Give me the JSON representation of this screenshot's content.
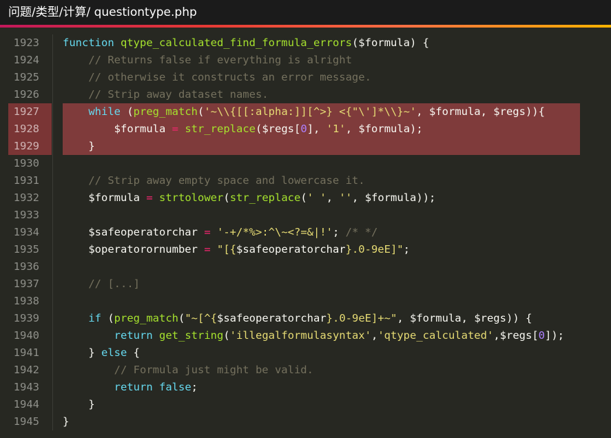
{
  "window": {
    "title": "问题/类型/计算/ questiontype.php"
  },
  "theme": {
    "background": "#272822",
    "highlight": "#7f3b3b",
    "accent": [
      "#c2185b",
      "#ffb300"
    ]
  },
  "lines": [
    {
      "n": "1923",
      "hl": false,
      "tokens": [
        {
          "t": "kw",
          "v": "function"
        },
        {
          "t": "punc",
          "v": " "
        },
        {
          "t": "fn",
          "v": "qtype_calculated_find_formula_errors"
        },
        {
          "t": "punc",
          "v": "("
        },
        {
          "t": "var",
          "v": "$formula"
        },
        {
          "t": "punc",
          "v": ") {"
        }
      ]
    },
    {
      "n": "1924",
      "hl": false,
      "tokens": [
        {
          "t": "com",
          "v": "    // Returns false if everything is alright"
        }
      ]
    },
    {
      "n": "1925",
      "hl": false,
      "tokens": [
        {
          "t": "com",
          "v": "    // otherwise it constructs an error message."
        }
      ]
    },
    {
      "n": "1926",
      "hl": false,
      "tokens": [
        {
          "t": "com",
          "v": "    // Strip away dataset names."
        }
      ]
    },
    {
      "n": "1927",
      "hl": true,
      "tokens": [
        {
          "t": "punc",
          "v": "    "
        },
        {
          "t": "kw",
          "v": "while"
        },
        {
          "t": "punc",
          "v": " ("
        },
        {
          "t": "fn",
          "v": "preg_match"
        },
        {
          "t": "punc",
          "v": "("
        },
        {
          "t": "str",
          "v": "'~\\\\{[[:alpha:]][^>} <{\"\\']*\\\\}~'"
        },
        {
          "t": "punc",
          "v": ", "
        },
        {
          "t": "var",
          "v": "$formula"
        },
        {
          "t": "punc",
          "v": ", "
        },
        {
          "t": "var",
          "v": "$regs"
        },
        {
          "t": "punc",
          "v": ")){"
        }
      ]
    },
    {
      "n": "1928",
      "hl": true,
      "tokens": [
        {
          "t": "punc",
          "v": "        "
        },
        {
          "t": "var",
          "v": "$formula"
        },
        {
          "t": "punc",
          "v": " "
        },
        {
          "t": "op",
          "v": "="
        },
        {
          "t": "punc",
          "v": " "
        },
        {
          "t": "fn",
          "v": "str_replace"
        },
        {
          "t": "punc",
          "v": "("
        },
        {
          "t": "var",
          "v": "$regs"
        },
        {
          "t": "punc",
          "v": "["
        },
        {
          "t": "num",
          "v": "0"
        },
        {
          "t": "punc",
          "v": "], "
        },
        {
          "t": "str",
          "v": "'1'"
        },
        {
          "t": "punc",
          "v": ", "
        },
        {
          "t": "var",
          "v": "$formula"
        },
        {
          "t": "punc",
          "v": ");"
        }
      ]
    },
    {
      "n": "1929",
      "hl": true,
      "tokens": [
        {
          "t": "punc",
          "v": "    }"
        }
      ]
    },
    {
      "n": "1930",
      "hl": false,
      "tokens": []
    },
    {
      "n": "1931",
      "hl": false,
      "tokens": [
        {
          "t": "com",
          "v": "    // Strip away empty space and lowercase it."
        }
      ]
    },
    {
      "n": "1932",
      "hl": false,
      "tokens": [
        {
          "t": "punc",
          "v": "    "
        },
        {
          "t": "var",
          "v": "$formula"
        },
        {
          "t": "punc",
          "v": " "
        },
        {
          "t": "op",
          "v": "="
        },
        {
          "t": "punc",
          "v": " "
        },
        {
          "t": "fn",
          "v": "strtolower"
        },
        {
          "t": "punc",
          "v": "("
        },
        {
          "t": "fn",
          "v": "str_replace"
        },
        {
          "t": "punc",
          "v": "("
        },
        {
          "t": "str",
          "v": "' '"
        },
        {
          "t": "punc",
          "v": ", "
        },
        {
          "t": "str",
          "v": "''"
        },
        {
          "t": "punc",
          "v": ", "
        },
        {
          "t": "var",
          "v": "$formula"
        },
        {
          "t": "punc",
          "v": "));"
        }
      ]
    },
    {
      "n": "1933",
      "hl": false,
      "tokens": []
    },
    {
      "n": "1934",
      "hl": false,
      "tokens": [
        {
          "t": "punc",
          "v": "    "
        },
        {
          "t": "var",
          "v": "$safeoperatorchar"
        },
        {
          "t": "punc",
          "v": " "
        },
        {
          "t": "op",
          "v": "="
        },
        {
          "t": "punc",
          "v": " "
        },
        {
          "t": "str",
          "v": "'-+/*%>:^\\~<?=&|!'"
        },
        {
          "t": "punc",
          "v": "; "
        },
        {
          "t": "com",
          "v": "/* */"
        }
      ]
    },
    {
      "n": "1935",
      "hl": false,
      "tokens": [
        {
          "t": "punc",
          "v": "    "
        },
        {
          "t": "var",
          "v": "$operatorornumber"
        },
        {
          "t": "punc",
          "v": " "
        },
        {
          "t": "op",
          "v": "="
        },
        {
          "t": "punc",
          "v": " "
        },
        {
          "t": "str",
          "v": "\"[{"
        },
        {
          "t": "var",
          "v": "$safeoperatorchar"
        },
        {
          "t": "str",
          "v": "}.0-9eE]\""
        },
        {
          "t": "punc",
          "v": ";"
        }
      ]
    },
    {
      "n": "1936",
      "hl": false,
      "tokens": []
    },
    {
      "n": "1937",
      "hl": false,
      "tokens": [
        {
          "t": "com",
          "v": "    // [...]"
        }
      ]
    },
    {
      "n": "1938",
      "hl": false,
      "tokens": []
    },
    {
      "n": "1939",
      "hl": false,
      "tokens": [
        {
          "t": "punc",
          "v": "    "
        },
        {
          "t": "kw",
          "v": "if"
        },
        {
          "t": "punc",
          "v": " ("
        },
        {
          "t": "fn",
          "v": "preg_match"
        },
        {
          "t": "punc",
          "v": "("
        },
        {
          "t": "str",
          "v": "\"~[^{"
        },
        {
          "t": "var",
          "v": "$safeoperatorchar"
        },
        {
          "t": "str",
          "v": "}.0-9eE]+~\""
        },
        {
          "t": "punc",
          "v": ", "
        },
        {
          "t": "var",
          "v": "$formula"
        },
        {
          "t": "punc",
          "v": ", "
        },
        {
          "t": "var",
          "v": "$regs"
        },
        {
          "t": "punc",
          "v": ")) {"
        }
      ]
    },
    {
      "n": "1940",
      "hl": false,
      "tokens": [
        {
          "t": "punc",
          "v": "        "
        },
        {
          "t": "kw",
          "v": "return"
        },
        {
          "t": "punc",
          "v": " "
        },
        {
          "t": "fn",
          "v": "get_string"
        },
        {
          "t": "punc",
          "v": "("
        },
        {
          "t": "str",
          "v": "'illegalformulasyntax'"
        },
        {
          "t": "punc",
          "v": ","
        },
        {
          "t": "str",
          "v": "'qtype_calculated'"
        },
        {
          "t": "punc",
          "v": ","
        },
        {
          "t": "var",
          "v": "$regs"
        },
        {
          "t": "punc",
          "v": "["
        },
        {
          "t": "num",
          "v": "0"
        },
        {
          "t": "punc",
          "v": "]);"
        }
      ]
    },
    {
      "n": "1941",
      "hl": false,
      "tokens": [
        {
          "t": "punc",
          "v": "    } "
        },
        {
          "t": "kw",
          "v": "else"
        },
        {
          "t": "punc",
          "v": " {"
        }
      ]
    },
    {
      "n": "1942",
      "hl": false,
      "tokens": [
        {
          "t": "com",
          "v": "        // Formula just might be valid."
        }
      ]
    },
    {
      "n": "1943",
      "hl": false,
      "tokens": [
        {
          "t": "punc",
          "v": "        "
        },
        {
          "t": "kw",
          "v": "return"
        },
        {
          "t": "punc",
          "v": " "
        },
        {
          "t": "kw",
          "v": "false"
        },
        {
          "t": "punc",
          "v": ";"
        }
      ]
    },
    {
      "n": "1944",
      "hl": false,
      "tokens": [
        {
          "t": "punc",
          "v": "    }"
        }
      ]
    },
    {
      "n": "1945",
      "hl": false,
      "tokens": [
        {
          "t": "punc",
          "v": "}"
        }
      ]
    }
  ]
}
